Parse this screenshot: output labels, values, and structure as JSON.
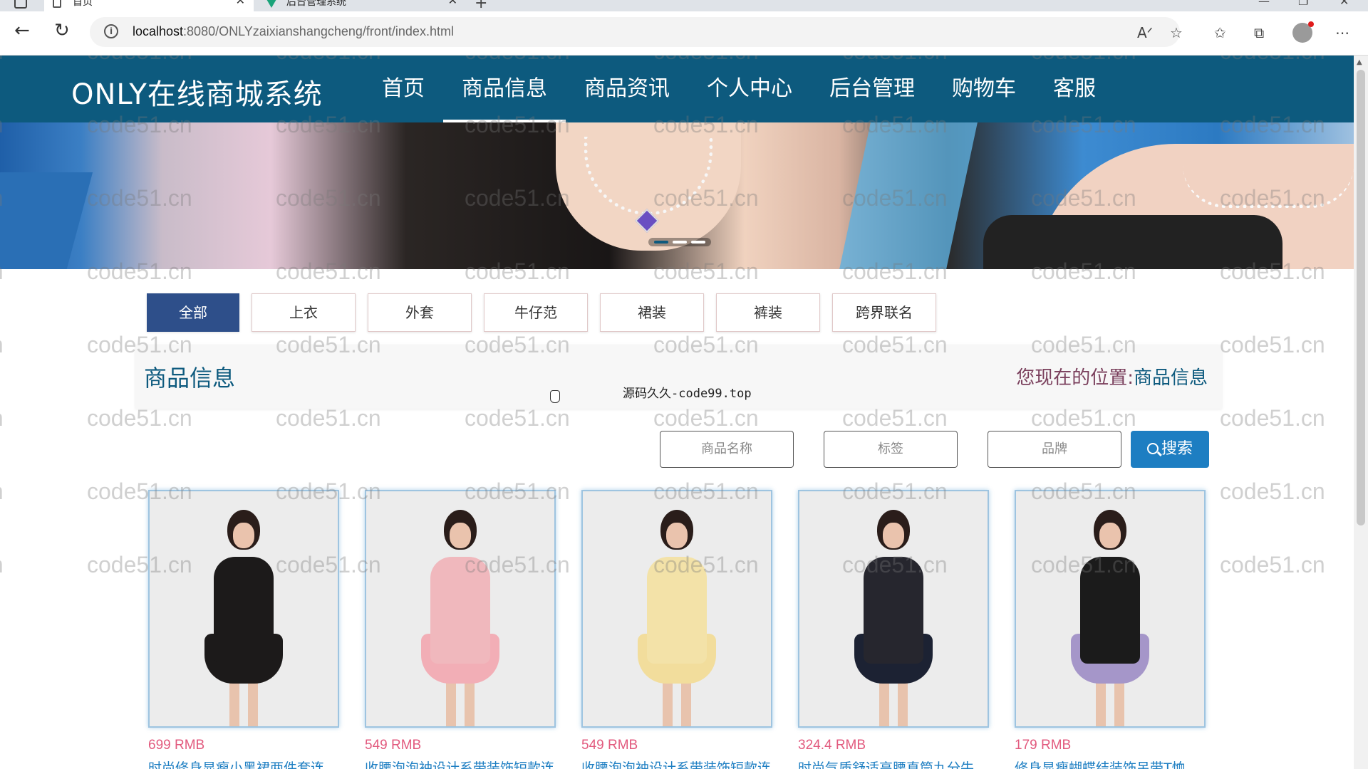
{
  "browser": {
    "tabs": [
      {
        "title": "首页",
        "active": true
      },
      {
        "title": "后台管理系统",
        "active": false
      }
    ],
    "url_host": "localhost",
    "url_path": ":8080/ONLYzaixianshangcheng/front/index.html"
  },
  "site": {
    "title": "ONLY在线商城系统",
    "nav": [
      "首页",
      "商品信息",
      "商品资讯",
      "个人中心",
      "后台管理",
      "购物车",
      "客服"
    ],
    "active_nav": "商品信息"
  },
  "categories": {
    "items": [
      "全部",
      "上衣",
      "外套",
      "牛仔范",
      "裙装",
      "裤装",
      "跨界联名"
    ],
    "active": "全部"
  },
  "page_header": {
    "title": "商品信息",
    "breadcrumb_prefix": "您现在的位置:",
    "breadcrumb_current": "商品信息",
    "source_note": "源码久久-code99.top"
  },
  "search": {
    "name_placeholder": "商品名称",
    "tag_placeholder": "标签",
    "brand_placeholder": "品牌",
    "button_label": "搜索"
  },
  "products": [
    {
      "price": "699 RMB",
      "name": "时尚修身显瘦小黑裙两件套连",
      "outfit": "#1c1a1a",
      "skirt": "#1c1a1a"
    },
    {
      "price": "549 RMB",
      "name": "收腰泡泡袖设计系带装饰短款连",
      "outfit": "#f0b8bd",
      "skirt": "#f2aeb6"
    },
    {
      "price": "549 RMB",
      "name": "收腰泡泡袖设计系带装饰短款连",
      "outfit": "#f3e2a8",
      "skirt": "#f2dd9c"
    },
    {
      "price": "324.4 RMB",
      "name": "时尚气质舒适高腰直筒九分牛",
      "outfit": "#26262e",
      "skirt": "#1c2233"
    },
    {
      "price": "179 RMB",
      "name": "修身显瘦蝴蝶结装饰吊带T恤",
      "outfit": "#1b1b1b",
      "skirt": "#a596c9"
    }
  ],
  "watermark_text": "code51.cn",
  "colors": {
    "header_bg": "#0d5a7e",
    "active_category": "#2e4f8a",
    "search_button": "#1d7ec2",
    "price": "#e25a7e"
  }
}
